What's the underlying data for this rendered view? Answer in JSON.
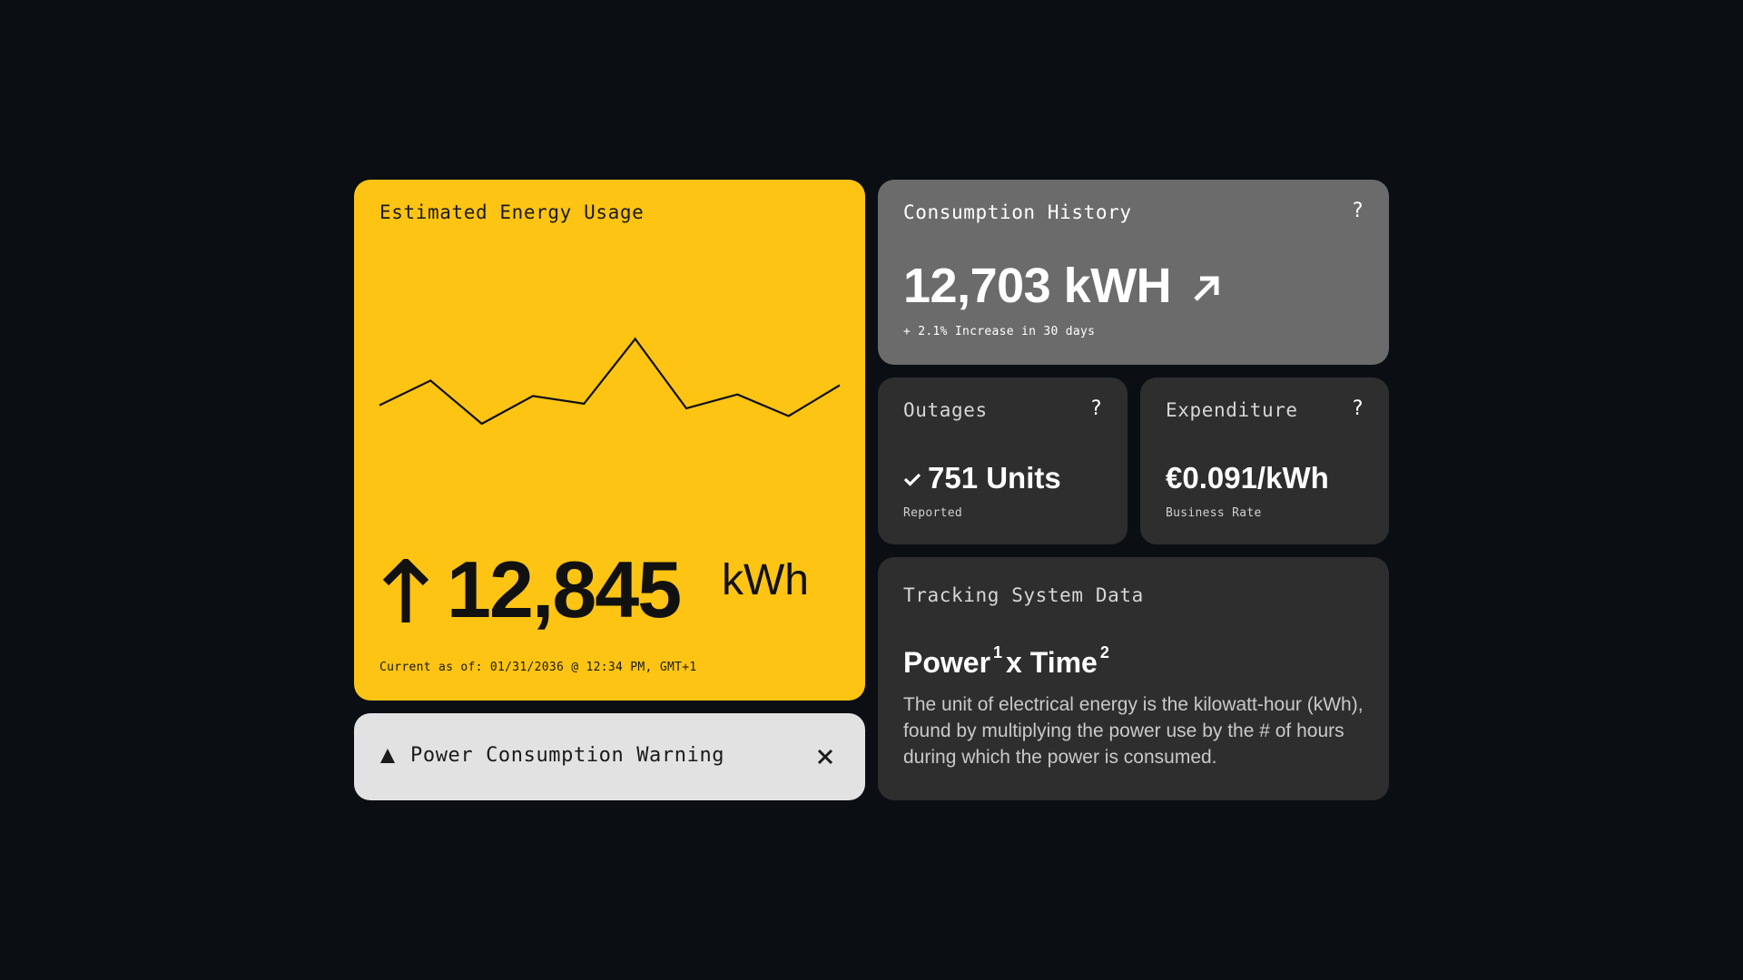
{
  "usage": {
    "title": "Estimated Energy Usage",
    "value": "12,845",
    "unit": "kWh",
    "timestamp": "Current as of: 01/31/2036 @ 12:34 PM, GMT+1",
    "trend_icon": "arrow-up-icon",
    "accent_color": "#fdc413"
  },
  "chart_data": {
    "type": "line",
    "title": "",
    "xlabel": "",
    "ylabel": "",
    "grid": false,
    "series": [
      {
        "values": [
          42,
          58,
          30,
          48,
          43,
          85,
          40,
          49,
          35,
          55
        ]
      }
    ],
    "ylim": [
      0,
      100
    ]
  },
  "warning": {
    "label": "Power Consumption Warning",
    "icon": "warning-triangle-icon",
    "close_icon": "close-icon"
  },
  "history": {
    "title": "Consumption History",
    "help": "?",
    "value": "12,703 kWH",
    "trend_icon": "arrow-up-right-icon",
    "subtitle": "+ 2.1% Increase in 30 days"
  },
  "outages": {
    "title": "Outages",
    "help": "?",
    "value": "751 Units",
    "caption": "Reported",
    "icon": "check-icon"
  },
  "expenditure": {
    "title": "Expenditure",
    "help": "?",
    "value": "€0.091/kWh",
    "caption": "Business Rate"
  },
  "tracking": {
    "title": "Tracking System Data",
    "formula_power": "Power",
    "formula_sup1": "1",
    "formula_times": "x Time",
    "formula_sup2": "2",
    "description": "The unit of electrical energy is the kilowatt-hour (kWh), found by multiplying the power use by the # of hours during which the power is consumed."
  }
}
